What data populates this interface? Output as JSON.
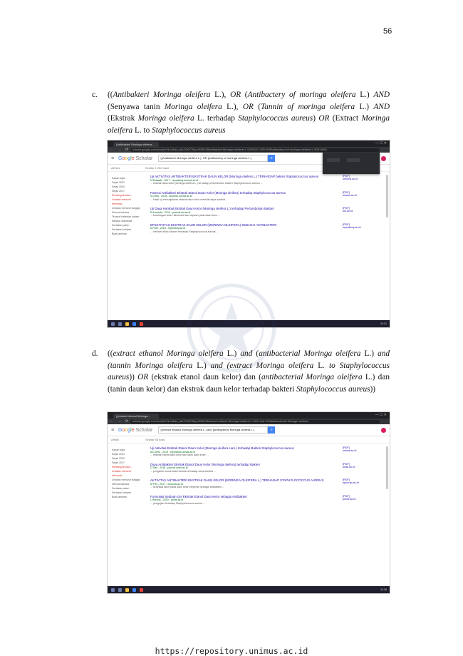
{
  "page_number": "56",
  "footer_url": "https://repository.unimus.ac.id",
  "item_c": {
    "label": "c.",
    "segments": [
      {
        "t": "((",
        "i": false
      },
      {
        "t": "Antibakteri Moringa oleifera",
        "i": true
      },
      {
        "t": " L.), ",
        "i": false
      },
      {
        "t": "OR",
        "i": true
      },
      {
        "t": " (",
        "i": false
      },
      {
        "t": "Antibactery of moringa oleifera",
        "i": true
      },
      {
        "t": " L.) ",
        "i": false
      },
      {
        "t": "AND",
        "i": true
      },
      {
        "t": " (Senyawa tanin ",
        "i": false
      },
      {
        "t": "Moringa oleifera",
        "i": true
      },
      {
        "t": " L.), ",
        "i": false
      },
      {
        "t": "OR",
        "i": true
      },
      {
        "t": " (",
        "i": false
      },
      {
        "t": "Tannin of moringa oleifera",
        "i": true
      },
      {
        "t": " L.) ",
        "i": false
      },
      {
        "t": "AND",
        "i": true
      },
      {
        "t": " (Ekstrak ",
        "i": false
      },
      {
        "t": "Moringa oleifera",
        "i": true
      },
      {
        "t": " L. terhadap ",
        "i": false
      },
      {
        "t": "Staphylococcus aureus",
        "i": true
      },
      {
        "t": ") ",
        "i": false
      },
      {
        "t": "OR",
        "i": true
      },
      {
        "t": " (Extract ",
        "i": false
      },
      {
        "t": "Moringa oleifera",
        "i": true
      },
      {
        "t": " L. to ",
        "i": false
      },
      {
        "t": "Staphylococcus aureus",
        "i": true
      }
    ]
  },
  "item_d": {
    "label": "d.",
    "segments": [
      {
        "t": "((",
        "i": false
      },
      {
        "t": "extract ethanol Moringa oleifera",
        "i": true
      },
      {
        "t": " L.) ",
        "i": false
      },
      {
        "t": "and",
        "i": true
      },
      {
        "t": " (",
        "i": false
      },
      {
        "t": "antibacterial Moringa oleifera",
        "i": true
      },
      {
        "t": " L.) ",
        "i": false
      },
      {
        "t": "and (tannin Moringa oleifera",
        "i": true
      },
      {
        "t": " L.) ",
        "i": false
      },
      {
        "t": "and (extract Moringa oleifera",
        "i": true
      },
      {
        "t": " L. ",
        "i": false
      },
      {
        "t": "to Staphylococcus aureus",
        "i": true
      },
      {
        "t": ")) ",
        "i": false
      },
      {
        "t": "OR",
        "i": true
      },
      {
        "t": " (ekstrak etanol daun kelor) dan (",
        "i": false
      },
      {
        "t": "antibacterial Moringa oleifera",
        "i": true
      },
      {
        "t": " L.) dan (tanin daun kelor) dan ekstrak daun kelor terhadap bakteri ",
        "i": false
      },
      {
        "t": "Staphylococcus aureus",
        "i": true
      },
      {
        "t": "))",
        "i": false
      }
    ]
  },
  "screenshot_1": {
    "tab_title": "(Antibakteri Moringa oleifera...",
    "url": "scholar.google.com/scholar?hl=id&as_sdt=0%2C5&q=%28%28Antibakteri+Moringa+oleifera+L.%29%2C+OR+%28Antibactery+of+moringa+oleifera+L.%29+AND...",
    "logo": [
      "G",
      "o",
      "o",
      "g",
      "l",
      "e"
    ],
    "logo_suffix": "Scholar",
    "query": "((Antibakteri Moringa oleifera L.), OR (Antibactery of moringa oleifera L.)",
    "all_label": "All files",
    "stats": "Sekitar 1.050 hasil",
    "sidebar": [
      "Kapan saja",
      "Sejak 2021",
      "Sejak 2020",
      "Sejak 2017",
      "Rentang khusus...",
      "Urutkan menurut relevansi",
      "Urutkan menurut tanggal",
      "Semua bahasa",
      "Telusuri halaman dalam bahasa Indonesia",
      "Sertakan paten",
      "Sertakan kutipan",
      "Buat lansiran"
    ],
    "results": [
      {
        "title": "Uji AKTIVITAS ANTIBAKTERI EKSTRAK DAUN KELOR (Moringa oleifera L.) TERHADAP bakteri Staphylococcus aureus",
        "green": "N Ekawati - 2017 - repository.unimus.ac.id",
        "snippet": "... ekstrak daun kelor (Moringa oleifera L.) terhadap pertumbuhan bakteri Staphylococcus aureus ...",
        "link": "[PDF] unimus.ac.id"
      },
      {
        "title": "Potensi Antibakteri Ekstrak Etanol Daun Kelor (Moringa oleifera) terhadap Staphylococcus aureus",
        "green": "S Dima - 2016 - ejournal.unsrat.ac.id",
        "snippet": "... Hasil uji menunjukkan ekstrak daun kelor memiliki daya hambat ...",
        "link": "[PDF] unsrat.ac.id"
      },
      {
        "title": "Uji Daya Hambat Ekstrak Daun Kelor (Moringa oleifera L.) terhadap Pertumbuhan Bakteri",
        "green": "R Amanda - 2019 - journal.uin.ac.id",
        "snippet": "... kandungan tanin, flavonoid dan saponin pada daun kelor ...",
        "link": "[PDF] uin.ac.id"
      },
      {
        "title": "EFEKTIVITAS EKSTRAK DAUN KELOR (MORINGA OLEIFERA) SEBAGAI ANTIBAKTERI",
        "green": "A Putri - 2018 - repository.ac.id",
        "snippet": "... metode difusi cakram terhadap Staphylococcus aureus ...",
        "link": "[PDF] repository.ac.id"
      }
    ],
    "clock": "10.21"
  },
  "screenshot_2": {
    "tab_title": "((extract ethanol Moringa...",
    "url": "scholar.google.com/scholar?hl=id&as_sdt=0%2C5&q=%28%28extract+ethanol+Moringa+oleifera+L.%29+and+%28antibacterial+Moringa+oleifera...",
    "logo": [
      "G",
      "o",
      "o",
      "g",
      "l",
      "e"
    ],
    "logo_suffix": "Scholar",
    "query": "((extract ethanol Moringa oleifera L.) and (antibacterial Moringa oleifera L.)",
    "all_label": "Artikel",
    "stats": "Sekitar 58 hasil",
    "sidebar": [
      "Kapan saja",
      "Sejak 2021",
      "Sejak 2020",
      "Sejak 2017",
      "Rentang khusus...",
      "Urutkan menurut relevansi",
      "Urutkan menurut tanggal",
      "Semua bahasa",
      "Sertakan paten",
      "Sertakan kutipan",
      "Buat lansiran"
    ],
    "results": [
      {
        "title": "Uji Aktivitas Ekstrak Etanol Daun Kelor (Moringa oleifera Lam.) terhadap Bakteri Staphylococcus aureus",
        "green": "AS Dewi - 2019 - repository.unhas.ac.id",
        "snippet": "... ekstrak etanol daun kelor dan tanin daun kelor ...",
        "link": "[PDF] unhas.ac.id"
      },
      {
        "title": "Daya Antibakteri Ekstrak Etanol Daun Kelor (Moringa oleifera) terhadap Bakteri",
        "green": "D Sari - 2018 - journal.unair.ac.id",
        "snippet": "... pengaruh konsentrasi ekstrak terhadap zona hambat ...",
        "link": "[PDF] unair.ac.id"
      },
      {
        "title": "AKTIVITAS ANTIBAKTERI EKSTRAK DAUN KELOR (MORINGA OLEIFERA L.) TERHADAP STAPHYLOCOCCUS AUREUS",
        "green": "M Fitri - 2017 - ejournal.ac.id",
        "snippet": "... senyawa tanin pada daun kelor berperan sebagai antibakteri ...",
        "link": "[PDF] ejournal.ac.id"
      },
      {
        "title": "Formulasi Sediaan Gel Ekstrak Etanol Daun Kelor sebagai Antibakteri",
        "green": "L Rahma - 2020 - jurnal.ac.id",
        "snippet": "... pengujian terhadap Staphylococcus aureus ...",
        "link": "[PDF] jurnal.ac.id"
      }
    ],
    "clock": "10.38"
  },
  "colors": {
    "link": "#1a0dab",
    "green": "#006621",
    "accent": "#4285f4"
  }
}
